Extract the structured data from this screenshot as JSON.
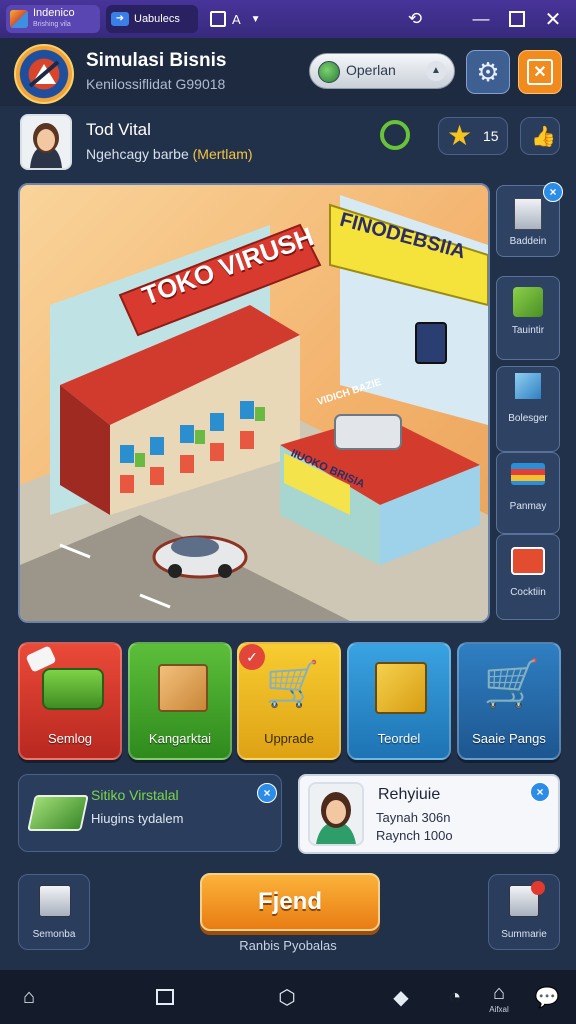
{
  "emulator": {
    "tab1_title": "Indenico",
    "tab1_sub": "Brishing vila",
    "tab2_title": "Uabulecs",
    "tab3_title": "A"
  },
  "header": {
    "title": "Simulasi Bisnis",
    "subtitle": "Kenilossiflidat G99018",
    "pill_label": "Operlan"
  },
  "profile": {
    "name": "Tod Vital",
    "status_prefix": "Ngehcagy barbe",
    "status_tag": "(Mertlam)",
    "stars": "15"
  },
  "scene": {
    "store1_sign": "TOKO VIRUSH",
    "store2_sign": "FINODEBSIIA",
    "kiosk_sign": "IIUOKO BRISIA",
    "banner": "VIDICH BAZIE"
  },
  "side_menu": [
    {
      "label": "Baddein"
    },
    {
      "label": "Tauintir"
    },
    {
      "label": "Bolesger"
    },
    {
      "label": "Panmay"
    },
    {
      "label": "Cocktiin"
    }
  ],
  "tiles": [
    {
      "label": "Semlog",
      "color": "#d8342c"
    },
    {
      "label": "Kangarktai",
      "color": "#3f9e2a"
    },
    {
      "label": "Upprade",
      "color": "#eab21c"
    },
    {
      "label": "Teordel",
      "color": "#2a86c6"
    },
    {
      "label": "Saaie Pangs",
      "color": "#2a6aa5"
    }
  ],
  "notification_left": {
    "title": "Sitiko Virstalal",
    "text": "Hiugins tydalem"
  },
  "notification_right": {
    "title": "Rehyiuie",
    "line1": "Taynah 306n",
    "line2": "Raynch 100o"
  },
  "bottom": {
    "left_label": "Semonba",
    "main_button": "Fjend",
    "main_sub": "Ranbis Pyobalas",
    "right_label": "Summarie"
  },
  "navbar": {
    "extra_label": "Aifxal"
  }
}
